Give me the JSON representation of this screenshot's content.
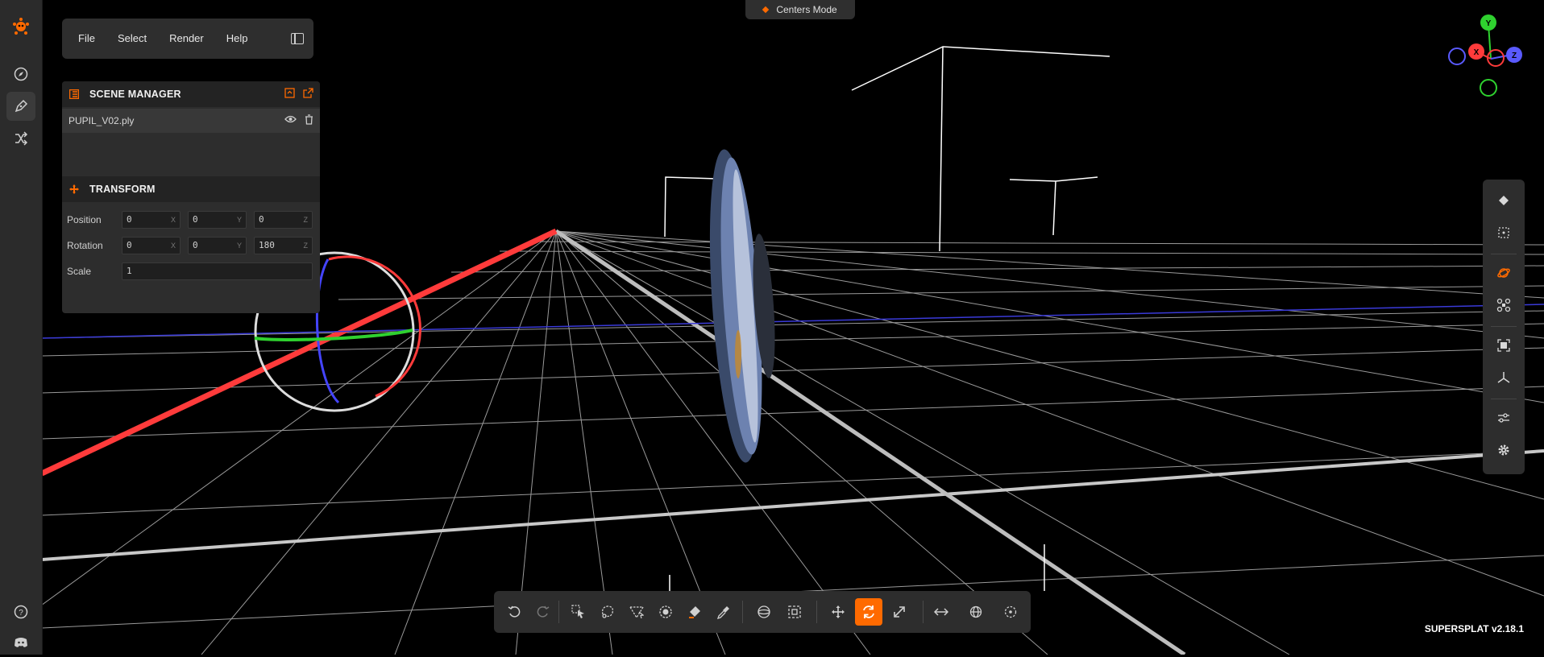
{
  "app": {
    "version": "SUPERSPLAT v2.18.1"
  },
  "menu": {
    "file": "File",
    "select": "Select",
    "render": "Render",
    "help": "Help"
  },
  "mode_pill": {
    "label": "Centers Mode"
  },
  "scene_manager": {
    "title": "SCENE MANAGER",
    "items": [
      {
        "name": "PUPIL_V02.ply"
      }
    ]
  },
  "transform": {
    "title": "TRANSFORM",
    "position": {
      "label": "Position",
      "x": "0",
      "y": "0",
      "z": "0"
    },
    "rotation": {
      "label": "Rotation",
      "x": "0",
      "y": "0",
      "z": "180"
    },
    "scale": {
      "label": "Scale",
      "value": "1"
    },
    "axis_labels": {
      "x": "X",
      "y": "Y",
      "z": "Z"
    }
  },
  "gizmo": {
    "x": "X",
    "y": "Y",
    "z": "Z"
  },
  "colors": {
    "accent": "#ff6a00",
    "x_axis": "#ff3b3b",
    "y_axis": "#2fd12f",
    "z_axis": "#5a5aff"
  },
  "tools": {
    "right": [
      "splat-icon",
      "select-box-icon",
      "orbit-camera-icon",
      "fly-camera-icon",
      "frame-selection-icon",
      "axes-icon",
      "view-options-icon",
      "settings-icon"
    ],
    "bottom": [
      "undo-icon",
      "redo-icon",
      "picker-select-icon",
      "lasso-select-icon",
      "polygon-select-icon",
      "brush-select-icon",
      "flood-select-icon",
      "eyedropper-icon",
      "sphere-select-icon",
      "box-select-icon",
      "move-icon",
      "rotate-icon",
      "scale-icon",
      "local-space-icon",
      "world-space-icon",
      "pivot-icon"
    ],
    "active_bottom": "rotate-icon"
  }
}
